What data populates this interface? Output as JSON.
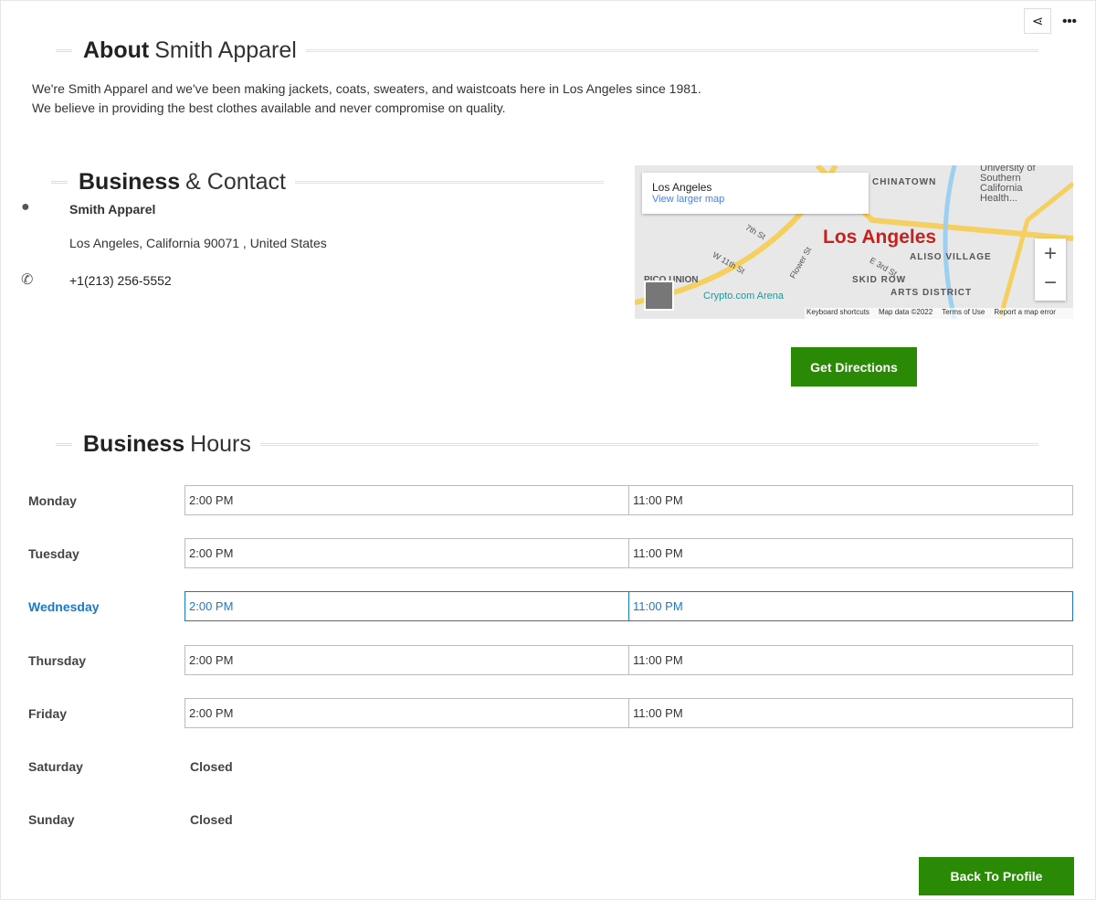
{
  "about": {
    "title_bold": "About",
    "title_light": "Smith Apparel",
    "lines": [
      "We're Smith Apparel and we've been making jackets, coats, sweaters, and waistcoats here in Los Angeles since 1981.",
      "We believe in providing the best clothes available and never compromise on quality."
    ]
  },
  "contact": {
    "title_bold": "Business",
    "title_light": "& Contact",
    "name": "Smith Apparel",
    "address": "Los Angeles, California 90071 , United States",
    "phone": "+1(213) 256-5552"
  },
  "map": {
    "place": "Los Angeles",
    "view_larger": "View larger map",
    "city_label": "Los Angeles",
    "labels": [
      "CHINATOWN",
      "ALISO VILLAGE",
      "SKID ROW",
      "ARTS DISTRICT",
      "Crypto.com Arena",
      "University of Southern California Health...",
      "7th St",
      "W 11th St",
      "Flower St",
      "E 3rd St",
      "PICO UNION"
    ],
    "footer": [
      "Keyboard shortcuts",
      "Map data ©2022",
      "Terms of Use",
      "Report a map error"
    ],
    "zoom_in": "+",
    "zoom_out": "−"
  },
  "directions_label": "Get Directions",
  "hours": {
    "title_bold": "Business",
    "title_light": "Hours",
    "days": [
      {
        "day": "Monday",
        "open": "2:00 PM",
        "close": "11:00 PM"
      },
      {
        "day": "Tuesday",
        "open": "2:00 PM",
        "close": "11:00 PM"
      },
      {
        "day": "Wednesday",
        "open": "2:00 PM",
        "close": "11:00 PM",
        "active": true
      },
      {
        "day": "Thursday",
        "open": "2:00 PM",
        "close": "11:00 PM"
      },
      {
        "day": "Friday",
        "open": "2:00 PM",
        "close": "11:00 PM"
      },
      {
        "day": "Saturday",
        "status": "Closed"
      },
      {
        "day": "Sunday",
        "status": "Closed"
      }
    ]
  },
  "back_label": "Back To Profile",
  "colors": {
    "accent": "#2a8a05",
    "active": "#1a7ac8"
  }
}
